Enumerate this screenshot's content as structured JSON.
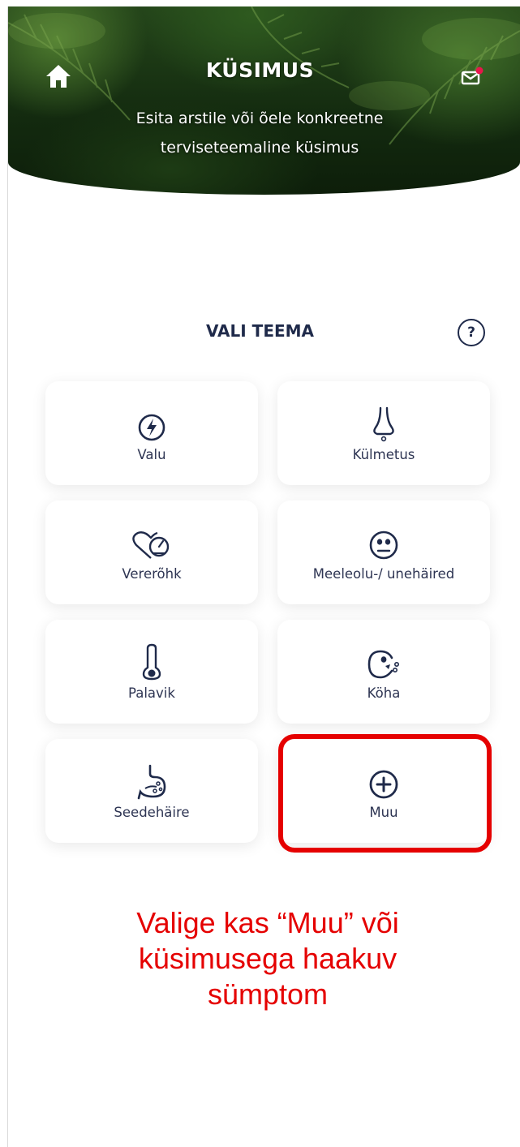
{
  "header": {
    "title": "KÜSIMUS",
    "subtitle": "Esita arstile või õele konkreetne terviseteemaline küsimus",
    "home_icon": "home-icon",
    "mail_icon": "envelope-icon",
    "mail_badge_color": "#e8174b"
  },
  "section": {
    "title": "VALI TEEMA",
    "help_label": "?"
  },
  "topics": [
    {
      "label": "Valu",
      "icon": "lightning-icon"
    },
    {
      "label": "Külmetus",
      "icon": "nose-icon"
    },
    {
      "label": "Vererõhk",
      "icon": "heart-gauge-icon"
    },
    {
      "label": "Meeleolu-/ unehäired",
      "icon": "face-icon"
    },
    {
      "label": "Palavik",
      "icon": "thermometer-icon"
    },
    {
      "label": "Köha",
      "icon": "cough-icon"
    },
    {
      "label": "Seedehäire",
      "icon": "stomach-icon"
    },
    {
      "label": "Muu",
      "icon": "plus-circle-icon"
    }
  ],
  "annotation": {
    "text": "Valige kas “Muu” või küsimusega haakuv sümptom",
    "color": "#e50000"
  },
  "colors": {
    "text_dark": "#1f2a4a",
    "tile_bg": "#ffffff",
    "highlight": "#e50000"
  }
}
